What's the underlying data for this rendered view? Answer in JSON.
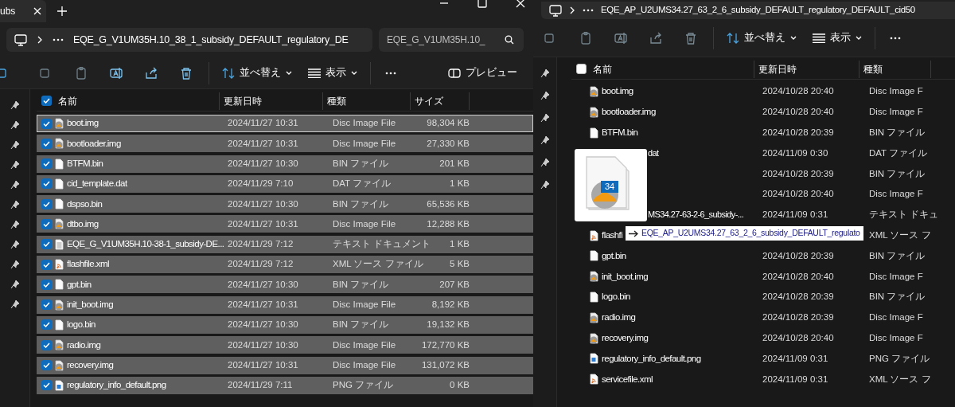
{
  "left_window": {
    "tab": {
      "label": "ubs"
    },
    "address": "EQE_G_V1UM35H.10_38_1_subsidy_DEFAULT_regulatory_DE",
    "search": {
      "placeholder": "EQE_G_V1UM35H.10_"
    },
    "toolbar": {
      "sort": "並べ替え",
      "view": "表示",
      "preview": "プレビュー"
    },
    "columns": [
      "名前",
      "更新日時",
      "種類",
      "サイズ"
    ],
    "select_all_checked": true,
    "rows": [
      {
        "kind": "disc",
        "name": "boot.img",
        "date": "2024/11/27 10:31",
        "type": "Disc Image File",
        "size": "98,304 KB",
        "selected": true,
        "focused": true
      },
      {
        "kind": "disc",
        "name": "bootloader.img",
        "date": "2024/11/27 10:31",
        "type": "Disc Image File",
        "size": "27,330 KB",
        "selected": true,
        "focused": false
      },
      {
        "kind": "file",
        "name": "BTFM.bin",
        "date": "2024/11/27 10:30",
        "type": "BIN ファイル",
        "size": "201 KB",
        "selected": true,
        "focused": false
      },
      {
        "kind": "file",
        "name": "cid_template.dat",
        "date": "2024/11/29 7:10",
        "type": "DAT ファイル",
        "size": "1 KB",
        "selected": true,
        "focused": false
      },
      {
        "kind": "file",
        "name": "dspso.bin",
        "date": "2024/11/27 10:30",
        "type": "BIN ファイル",
        "size": "65,536 KB",
        "selected": true,
        "focused": false
      },
      {
        "kind": "disc",
        "name": "dtbo.img",
        "date": "2024/11/27 10:31",
        "type": "Disc Image File",
        "size": "12,288 KB",
        "selected": true,
        "focused": false
      },
      {
        "kind": "text",
        "name": "EQE_G_V1UM35H.10-38-1_subsidy-DE...",
        "date": "2024/11/29 7:12",
        "type": "テキスト ドキュメント",
        "size": "1 KB",
        "selected": true,
        "focused": false
      },
      {
        "kind": "xml",
        "name": "flashfile.xml",
        "date": "2024/11/29 7:12",
        "type": "XML ソース ファイル",
        "size": "5 KB",
        "selected": true,
        "focused": false
      },
      {
        "kind": "file",
        "name": "gpt.bin",
        "date": "2024/11/27 10:30",
        "type": "BIN ファイル",
        "size": "207 KB",
        "selected": true,
        "focused": false
      },
      {
        "kind": "disc",
        "name": "init_boot.img",
        "date": "2024/11/27 10:31",
        "type": "Disc Image File",
        "size": "8,192 KB",
        "selected": true,
        "focused": false
      },
      {
        "kind": "file",
        "name": "logo.bin",
        "date": "2024/11/27 10:30",
        "type": "BIN ファイル",
        "size": "19,132 KB",
        "selected": true,
        "focused": false
      },
      {
        "kind": "disc",
        "name": "radio.img",
        "date": "2024/11/27 10:30",
        "type": "Disc Image File",
        "size": "172,770 KB",
        "selected": true,
        "focused": false
      },
      {
        "kind": "disc",
        "name": "recovery.img",
        "date": "2024/11/27 10:31",
        "type": "Disc Image File",
        "size": "131,072 KB",
        "selected": true,
        "focused": false
      },
      {
        "kind": "png",
        "name": "regulatory_info_default.png",
        "date": "2024/11/29 7:11",
        "type": "PNG ファイル",
        "size": "0 KB",
        "selected": true,
        "focused": false
      }
    ]
  },
  "right_window": {
    "address": "EQE_AP_U2UMS34.27_63_2_6_subsidy_DEFAULT_regulatory_DEFAULT_cid50",
    "toolbar": {
      "sort": "並べ替え",
      "view": "表示"
    },
    "columns": [
      "名前",
      "更新日時",
      "種類"
    ],
    "select_all_checked": false,
    "rows": [
      {
        "kind": "disc",
        "name": "boot.img",
        "date": "2024/10/28 20:40",
        "type": "Disc Image F",
        "selected": false
      },
      {
        "kind": "disc",
        "name": "bootloader.img",
        "date": "2024/10/28 20:40",
        "type": "Disc Image F",
        "selected": false
      },
      {
        "kind": "file",
        "name": "BTFM.bin",
        "date": "2024/10/28 20:39",
        "type": "BIN ファイル",
        "selected": false
      },
      {
        "kind": "hidden",
        "name": "dat",
        "date": "2024/11/09 0:30",
        "type": "DAT ファイル",
        "selected": false
      },
      {
        "kind": "hidden",
        "date": "2024/10/28 20:39",
        "type": "BIN ファイル",
        "selected": false
      },
      {
        "kind": "hidden",
        "date": "2024/10/28 20:40",
        "type": "Disc Image F",
        "selected": false
      },
      {
        "kind": "hidden",
        "name": "MS34.27-63-2-6_subsidy-...",
        "date": "2024/11/09 0:31",
        "type": "テキスト ドキュ",
        "selected": false
      },
      {
        "kind": "xml",
        "name": "flashfi",
        "type": "XML ソース フ",
        "selected": false
      },
      {
        "kind": "file",
        "name": "gpt.bin",
        "date": "2024/10/28 20:39",
        "type": "BIN ファイル",
        "selected": false
      },
      {
        "kind": "disc",
        "name": "init_boot.img",
        "date": "2024/10/28 20:40",
        "type": "Disc Image F",
        "selected": false
      },
      {
        "kind": "file",
        "name": "logo.bin",
        "date": "2024/10/28 20:39",
        "type": "BIN ファイル",
        "selected": false
      },
      {
        "kind": "disc",
        "name": "radio.img",
        "date": "2024/10/28 20:39",
        "type": "Disc Image F",
        "selected": false
      },
      {
        "kind": "disc",
        "name": "recovery.img",
        "date": "2024/10/28 20:40",
        "type": "Disc Image F",
        "selected": false
      },
      {
        "kind": "png",
        "name": "regulatory_info_default.png",
        "date": "2024/11/09 0:31",
        "type": "PNG ファイル",
        "selected": false
      },
      {
        "kind": "xml",
        "name": "servicefile.xml",
        "date": "2024/11/09 0:31",
        "type": "XML ソース フ",
        "selected": false
      }
    ]
  },
  "drag": {
    "count": "34",
    "target": "EQE_AP_U2UMS34.27_63_2_6_subsidy_DEFAULT_regulato"
  }
}
